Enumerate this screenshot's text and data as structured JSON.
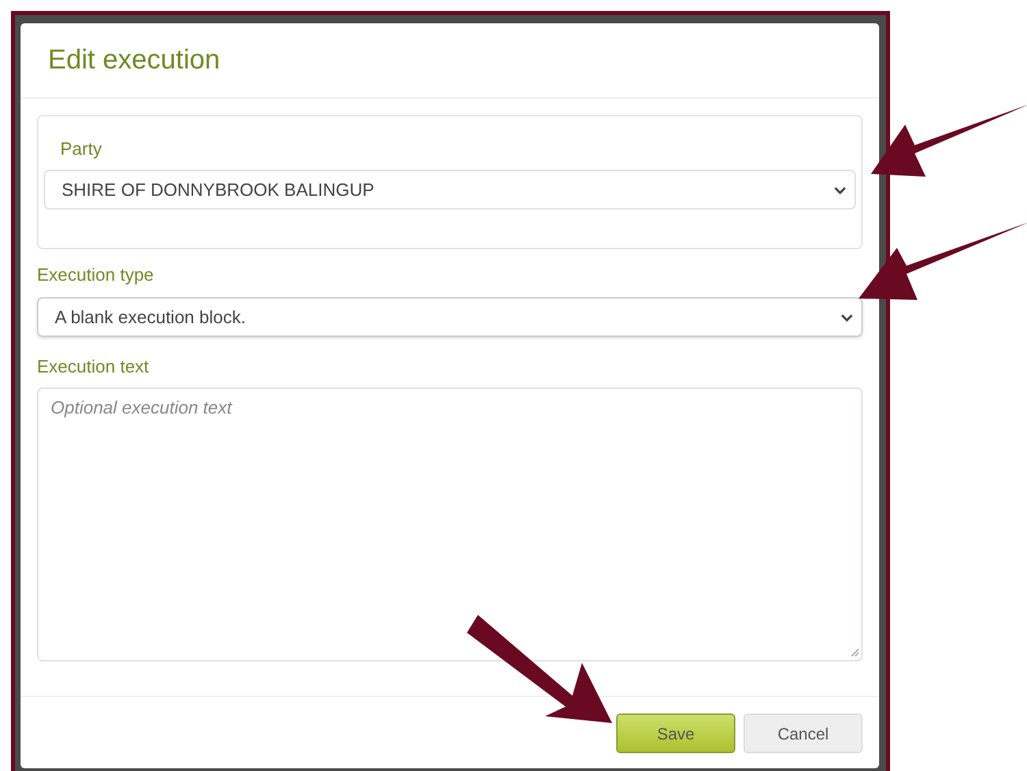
{
  "dialog": {
    "title": "Edit execution"
  },
  "party": {
    "label": "Party",
    "value": "SHIRE OF DONNYBROOK BALINGUP"
  },
  "execution_type": {
    "label": "Execution type",
    "value": "A blank execution block."
  },
  "execution_text": {
    "label": "Execution text",
    "placeholder": "Optional execution text"
  },
  "buttons": [
    {
      "label": "Save",
      "kind": "primary"
    },
    {
      "label": "Cancel",
      "kind": "secondary"
    }
  ]
}
